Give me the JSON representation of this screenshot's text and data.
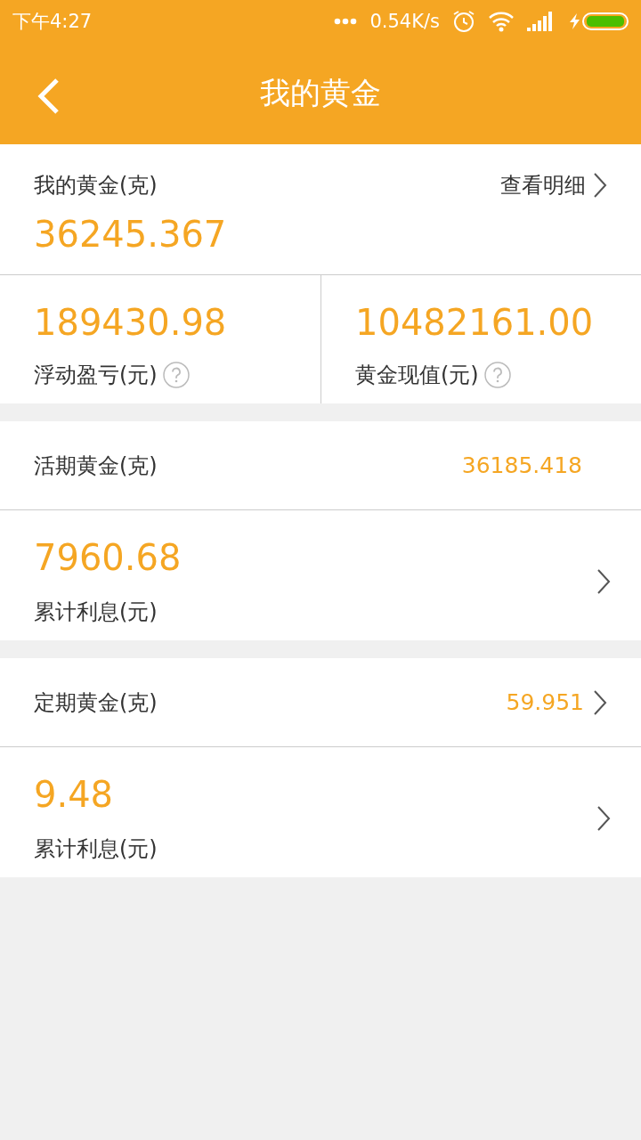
{
  "status_bar": {
    "time": "下午4:27",
    "network_speed": "0.54K/s"
  },
  "title": "我的黄金",
  "summary": {
    "label": "我的黄金(克)",
    "value": "36245.367",
    "link": "查看明细"
  },
  "stats": [
    {
      "value": "189430.98",
      "label": "浮动盈亏(元)"
    },
    {
      "value": "10482161.00",
      "label": "黄金现值(元)"
    }
  ],
  "sections": [
    {
      "label": "活期黄金(克)",
      "value": "36185.418",
      "link": false,
      "detail": {
        "value": "7960.68",
        "label": "累计利息(元)"
      }
    },
    {
      "label": "定期黄金(克)",
      "value": "59.951",
      "link": true,
      "detail": {
        "value": "9.48",
        "label": "累计利息(元)"
      }
    }
  ]
}
